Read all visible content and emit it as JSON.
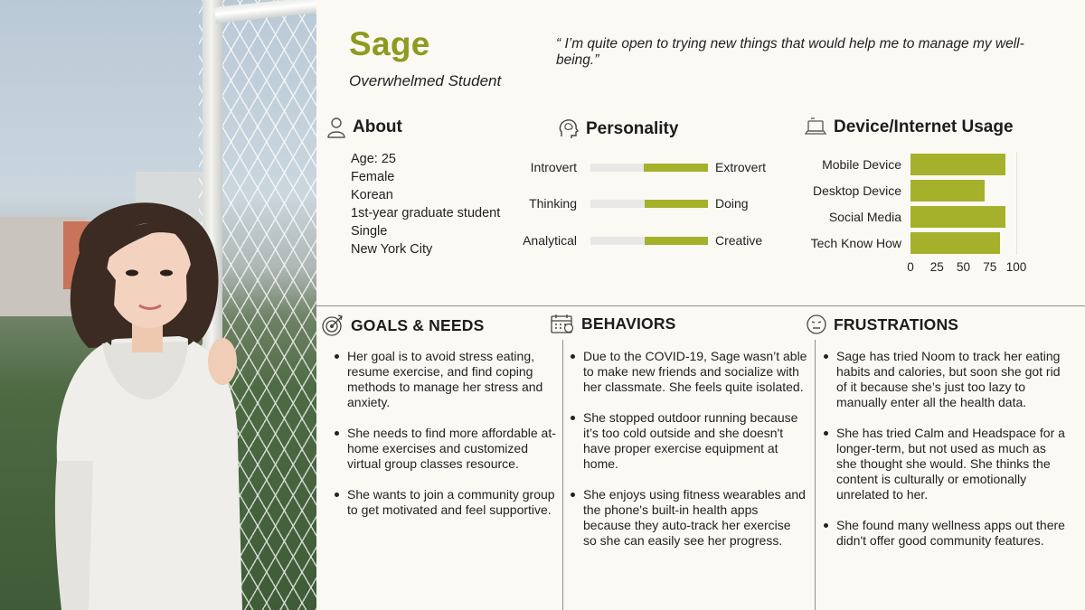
{
  "persona": {
    "name": "Sage",
    "role": "Overwhelmed Student",
    "quote": "“ I’m quite open to trying new things that would help me to manage my well-being.”"
  },
  "about": {
    "title": "About",
    "items": [
      "Age: 25",
      "Female",
      "Korean",
      "1st-year graduate student",
      "Single",
      "New York City"
    ]
  },
  "personality": {
    "title": "Personality",
    "traits": [
      {
        "left": "Introvert",
        "right": "Extrovert",
        "value": 0.45
      },
      {
        "left": "Thinking",
        "right": "Doing",
        "value": 0.46
      },
      {
        "left": "Analytical",
        "right": "Creative",
        "value": 0.46
      }
    ]
  },
  "device": {
    "title": "Device/Internet Usage"
  },
  "chart_data": {
    "type": "bar",
    "orientation": "horizontal",
    "title": "Device/Internet Usage",
    "categories": [
      "Mobile Device",
      "Desktop Device",
      "Social Media",
      "Tech Know How"
    ],
    "values": [
      90,
      70,
      90,
      85
    ],
    "xlim": [
      0,
      100
    ],
    "xticks": [
      "0",
      "25",
      "50",
      "75",
      "100"
    ],
    "grid": false,
    "color": "#a5b12b"
  },
  "goals": {
    "title": "GOALS & NEEDS",
    "items": [
      "Her goal is to avoid stress eating, resume exercise, and find coping methods to manage her stress and anxiety.",
      "She needs to find more affordable at-home exercises and customized virtual group classes resource.",
      "She wants to join a community group to get motivated and feel supportive."
    ]
  },
  "behaviors": {
    "title": "BEHAVIORS",
    "items": [
      "Due to the COVID-19, Sage wasn’t able to make new friends and socialize with her classmate. She feels quite isolated.",
      "She stopped outdoor running because it’s too cold outside and she doesn't have proper exercise equipment at home.",
      "She enjoys using fitness wearables and the phone's built-in health apps because they auto-track her exercise so she can easily see her progress."
    ]
  },
  "frustrations": {
    "title": "FRUSTRATIONS",
    "items": [
      "Sage has tried Noom to track her eating habits and calories, but soon she got rid of it because she’s just too lazy to manually enter all the health data.",
      "She has tried Calm and Headspace for a longer-term, but not used as much as she thought she would. She thinks the content is culturally or emotionally unrelated to her.",
      "She found many wellness apps out there didn't offer good community features."
    ]
  },
  "colors": {
    "accent": "#8d9b1f",
    "bar": "#a5b12b",
    "track": "#e8e8e6",
    "background": "#fbf9f4"
  },
  "icons": {
    "about": "person-icon",
    "personality": "brain-head-icon",
    "device": "laptop-icon",
    "goals": "target-icon",
    "behaviors": "calendar-icon",
    "frustrations": "frown-face-icon"
  }
}
